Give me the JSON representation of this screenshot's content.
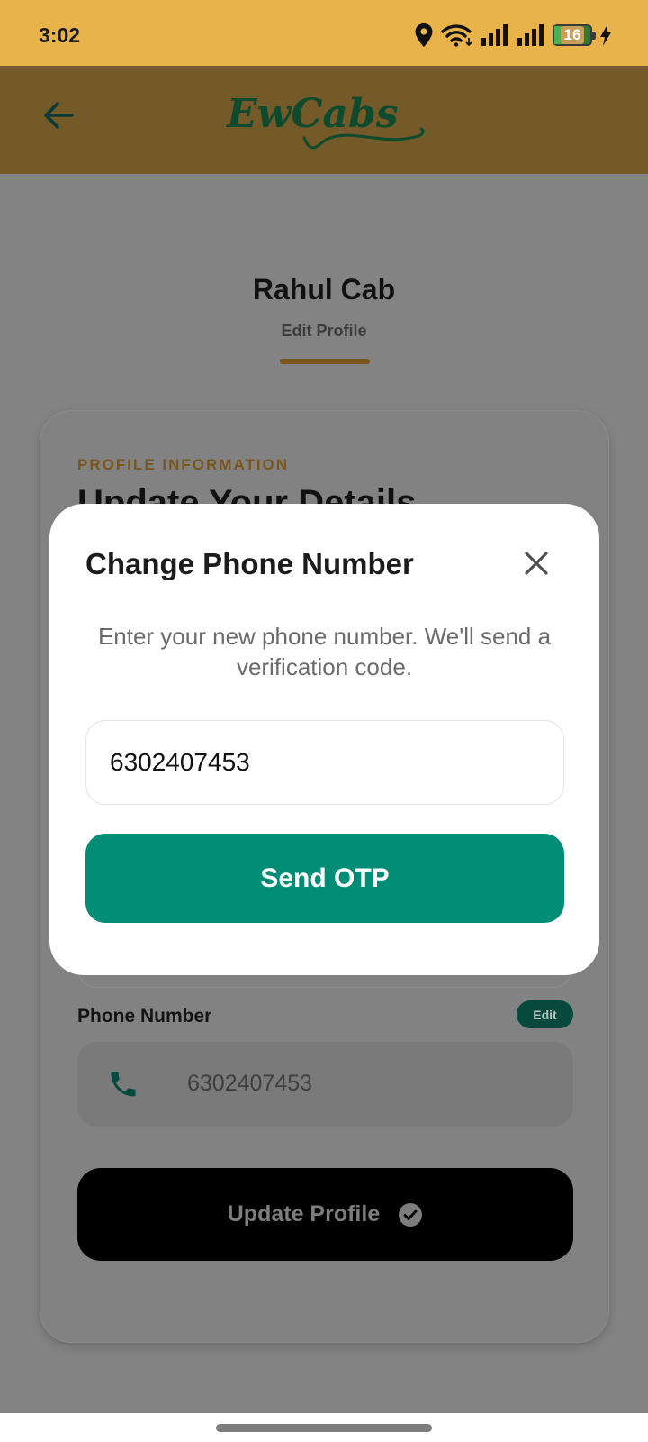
{
  "status_bar": {
    "time": "3:02",
    "battery_level": "16",
    "icons": [
      "location-icon",
      "wifi-icon",
      "signal-icon",
      "signal-icon",
      "battery-icon",
      "charging-icon"
    ]
  },
  "header": {
    "logo_text": "EwCabs",
    "back_icon": "arrow-left-icon"
  },
  "profile": {
    "name": "Rahul Cab",
    "subtitle": "Edit Profile"
  },
  "card": {
    "section_label": "PROFILE INFORMATION",
    "section_title": "Update Your Details",
    "phone_label": "Phone Number",
    "edit_label": "Edit",
    "phone_value": "6302407453",
    "update_button": "Update Profile"
  },
  "modal": {
    "title": "Change Phone Number",
    "description": "Enter your new phone number. We'll send a verification code.",
    "phone_input_value": "6302407453",
    "send_button": "Send OTP"
  },
  "colors": {
    "status_bar": "#E9B34B",
    "header_dimmed": "#745A28",
    "accent_green": "#028D76",
    "logo_green": "#0E4A2E"
  }
}
